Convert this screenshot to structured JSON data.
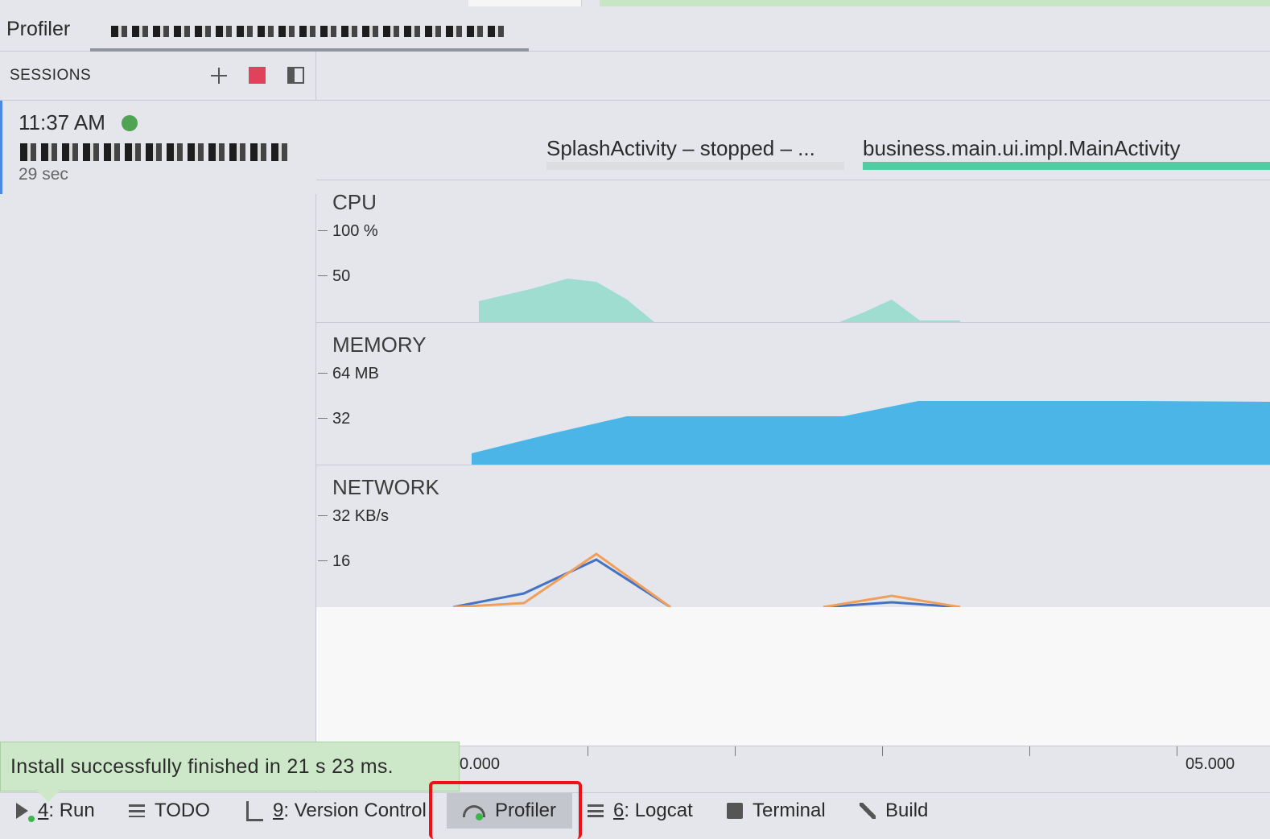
{
  "profiler": {
    "title": "Profiler"
  },
  "sessions": {
    "label": "SESSIONS",
    "items": [
      {
        "time": "11:37 AM",
        "duration": "29 sec",
        "status_color": "#4fa352"
      }
    ]
  },
  "activities": [
    {
      "label": "SplashActivity – stopped – ...",
      "bar_color": "#dcdde0"
    },
    {
      "label": "business.main.ui.impl.MainActivity",
      "bar_color": "#55cba3"
    }
  ],
  "monitors": {
    "cpu": {
      "title": "CPU",
      "max": "100 %",
      "mid": "50",
      "color": "#9fddd0"
    },
    "memory": {
      "title": "MEMORY",
      "max": "64 MB",
      "mid": "32",
      "color": "#4bb5e8"
    },
    "network": {
      "title": "NETWORK",
      "max": "32 KB/s",
      "mid": "16",
      "colors": [
        "#f1a05b",
        "#4472c4"
      ]
    }
  },
  "timeline": {
    "labels": [
      "0.000",
      "05.000"
    ]
  },
  "notification": {
    "text": "Install successfully finished in 21 s 23 ms."
  },
  "toolbar": {
    "items": [
      {
        "prefix": "4",
        "label": ": Run",
        "icon": "run-icon"
      },
      {
        "prefix": "",
        "label": "TODO",
        "icon": "list-icon"
      },
      {
        "prefix": "9",
        "label": ": Version Control",
        "icon": "version-control-icon"
      },
      {
        "prefix": "",
        "label": "Profiler",
        "icon": "profiler-gauge-icon",
        "active": true
      },
      {
        "prefix": "6",
        "label": ": Logcat",
        "icon": "logcat-icon"
      },
      {
        "prefix": "",
        "label": "Terminal",
        "icon": "terminal-icon"
      },
      {
        "prefix": "",
        "label": "Build",
        "icon": "hammer-icon"
      }
    ]
  }
}
